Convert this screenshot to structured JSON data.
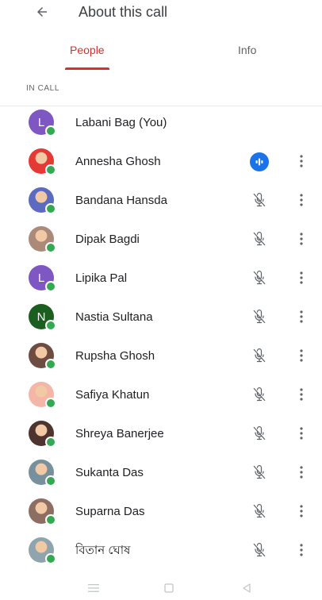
{
  "header": {
    "title": "About this call",
    "back_icon": "arrow-back-icon"
  },
  "tabs": [
    {
      "label": "People",
      "selected": true
    },
    {
      "label": "Info",
      "selected": false
    }
  ],
  "section": {
    "label": "IN CALL"
  },
  "colors": {
    "accent": "#d93025",
    "speaking": "#1a73e8",
    "online": "#34a853"
  },
  "participants": [
    {
      "name": "Labani Bag (You)",
      "initial": "L",
      "avatar_color": "#7e57c2",
      "mic": "none"
    },
    {
      "name": "Annesha Ghosh",
      "initial": "",
      "avatar_color": "#e53935",
      "mic": "speaking"
    },
    {
      "name": "Bandana Hansda",
      "initial": "",
      "avatar_color": "#5c6bc0",
      "mic": "muted"
    },
    {
      "name": "Dipak Bagdi",
      "initial": "",
      "avatar_color": "#ab8a7a",
      "mic": "muted"
    },
    {
      "name": "Lipika Pal",
      "initial": "L",
      "avatar_color": "#7e57c2",
      "mic": "muted"
    },
    {
      "name": "Nastia Sultana",
      "initial": "N",
      "avatar_color": "#1b5e20",
      "mic": "muted"
    },
    {
      "name": "Rupsha Ghosh",
      "initial": "",
      "avatar_color": "#6d4c41",
      "mic": "muted"
    },
    {
      "name": "Safiya Khatun",
      "initial": "",
      "avatar_color": "#f4b6a6",
      "mic": "muted"
    },
    {
      "name": "Shreya Banerjee",
      "initial": "",
      "avatar_color": "#4e342e",
      "mic": "muted"
    },
    {
      "name": "Sukanta Das",
      "initial": "",
      "avatar_color": "#78909c",
      "mic": "muted"
    },
    {
      "name": "Suparna Das",
      "initial": "",
      "avatar_color": "#8d6e63",
      "mic": "muted"
    },
    {
      "name": "বিতান ঘোষ",
      "initial": "",
      "avatar_color": "#90a4ae",
      "mic": "muted"
    }
  ],
  "navbar": {
    "icons": [
      "menu-icon",
      "home-icon",
      "back-triangle-icon"
    ]
  }
}
